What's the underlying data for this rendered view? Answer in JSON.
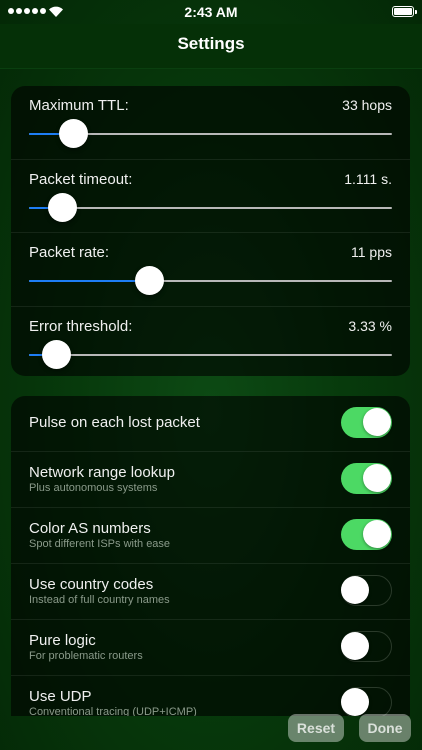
{
  "status": {
    "time": "2:43 AM",
    "signal_bars": 5,
    "battery_level": 1.0
  },
  "nav": {
    "title": "Settings"
  },
  "sliders": [
    {
      "label": "Maximum TTL:",
      "value": "33 hops",
      "fraction": 0.12
    },
    {
      "label": "Packet timeout:",
      "value": "1.111 s.",
      "fraction": 0.09
    },
    {
      "label": "Packet rate:",
      "value": "11 pps",
      "fraction": 0.33
    },
    {
      "label": "Error threshold:",
      "value": "3.33 %",
      "fraction": 0.075
    }
  ],
  "toggles": [
    {
      "label": "Pulse on each lost packet",
      "subtitle": "",
      "on": true
    },
    {
      "label": "Network range lookup",
      "subtitle": "Plus autonomous systems",
      "on": true
    },
    {
      "label": "Color AS numbers",
      "subtitle": "Spot different ISPs with ease",
      "on": true
    },
    {
      "label": "Use country codes",
      "subtitle": "Instead of full country names",
      "on": false
    },
    {
      "label": "Pure logic",
      "subtitle": "For problematic routers",
      "on": false
    },
    {
      "label": "Use UDP",
      "subtitle": "Conventional tracing (UDP+ICMP)",
      "on": false
    }
  ],
  "buttons": {
    "reset": "Reset",
    "done": "Done"
  },
  "colors": {
    "accent": "#1e7ef5",
    "switch_on": "#4cd964"
  }
}
